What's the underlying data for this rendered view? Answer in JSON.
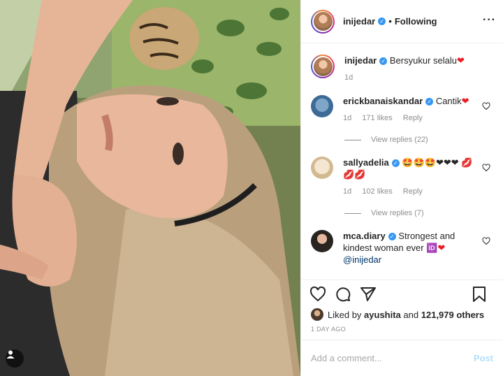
{
  "header": {
    "username": "inijedar",
    "separator": "•",
    "follow_status": "Following"
  },
  "caption": {
    "username": "inijedar",
    "text": "Bersyukur selalu",
    "emoji": "❤",
    "time": "1d"
  },
  "comments": [
    {
      "username": "erickbanaiskandar",
      "text": "Cantik",
      "emoji": "❤",
      "time": "1d",
      "likes": "171 likes",
      "reply": "Reply",
      "view_replies": "View replies (22)"
    },
    {
      "username": "sallyadelia",
      "text": "🤩🤩🤩❤❤❤ 💋💋💋",
      "time": "1d",
      "likes": "102 likes",
      "reply": "Reply",
      "view_replies": "View replies (7)"
    },
    {
      "username": "mca.diary",
      "text": "Strongest and kindest woman ever 🆔",
      "emoji": "❤",
      "mention": "@inijedar"
    }
  ],
  "likes": {
    "prefix": "Liked by",
    "user": "ayushita",
    "conj": "and",
    "others": "121,979 others"
  },
  "timeago": "1 DAY AGO",
  "comment_box": {
    "placeholder": "Add a comment...",
    "post_label": "Post"
  },
  "icons": [
    "user-tag-icon",
    "more-icon",
    "verified-icon",
    "heart-icon",
    "comment-icon",
    "share-icon",
    "save-icon"
  ],
  "colors": {
    "verified": "#3897f0",
    "post_button": "#b2dffc",
    "heart": "#ed1c24"
  }
}
